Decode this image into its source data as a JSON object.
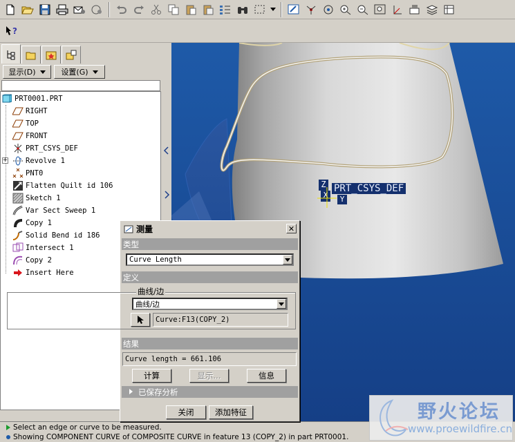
{
  "panel": {
    "show_menu_label": "显示(D)",
    "settings_menu_label": "设置(G)"
  },
  "tree": {
    "items": [
      {
        "label": "PRT0001.PRT",
        "icon": "part-icon"
      },
      {
        "label": "RIGHT",
        "icon": "datum-plane-icon"
      },
      {
        "label": "TOP",
        "icon": "datum-plane-icon"
      },
      {
        "label": "FRONT",
        "icon": "datum-plane-icon"
      },
      {
        "label": "PRT_CSYS_DEF",
        "icon": "csys-icon"
      },
      {
        "label": "Revolve 1",
        "icon": "revolve-icon"
      },
      {
        "label": "PNT0",
        "icon": "datum-point-icon"
      },
      {
        "label": "Flatten Quilt id 106",
        "icon": "flatten-quilt-icon"
      },
      {
        "label": "Sketch 1",
        "icon": "sketch-icon"
      },
      {
        "label": "Var Sect Sweep 1",
        "icon": "sweep-icon"
      },
      {
        "label": "Copy 1",
        "icon": "copy-icon"
      },
      {
        "label": "Solid Bend id 186",
        "icon": "solid-bend-icon"
      },
      {
        "label": "Intersect 1",
        "icon": "intersect-icon"
      },
      {
        "label": "Copy 2",
        "icon": "copy-curve-icon"
      },
      {
        "label": "Insert Here",
        "icon": "insert-here-arrow-icon"
      }
    ]
  },
  "viewport": {
    "csys_label": "PRT_CSYS_DEF",
    "axis_z": "Z",
    "axis_x": "X",
    "axis_y": "Y"
  },
  "dialog": {
    "title": "测量",
    "type_section": "类型",
    "type_value": "Curve Length",
    "definition_section": "定义",
    "group_label": "曲线/边",
    "curve_combo_value": "曲线/边",
    "curve_selection_value": "Curve:F13(COPY_2)",
    "results_section": "结果",
    "result_value": "Curve length = 661.106",
    "compute_button": "计算",
    "display_button": "显示...",
    "info_button": "信息",
    "saved_analysis": "已保存分析",
    "close_button": "关闭",
    "add_feature_button": "添加特征"
  },
  "status": {
    "line1": "Select an edge or curve to be measured.",
    "line2": "Showing COMPONENT CURVE of COMPOSITE CURVE in feature 13 (COPY_2) in part PRT0001."
  },
  "watermark": {
    "title": "野火论坛",
    "url": "www.proewildfire.cn"
  }
}
